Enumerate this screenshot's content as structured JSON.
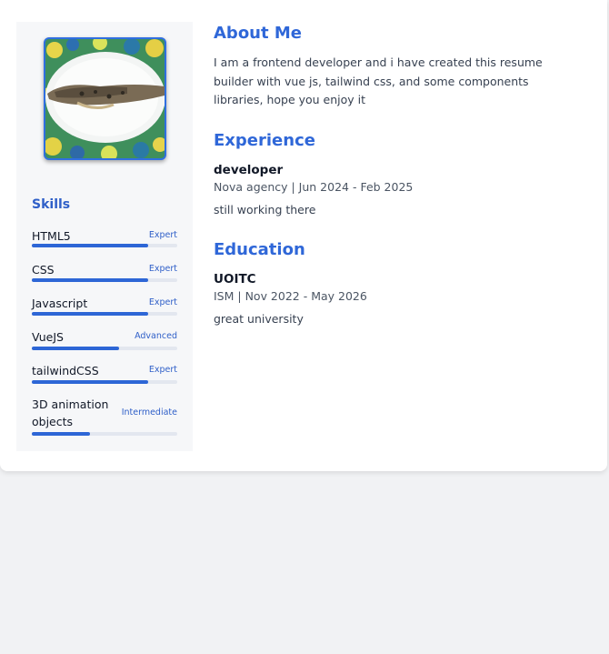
{
  "profile": {
    "photo_alt": "profile photo of a fish on a plate"
  },
  "skills": {
    "title": "Skills",
    "items": [
      {
        "name": "HTML5",
        "level": "Expert",
        "progress": 0.8
      },
      {
        "name": "CSS",
        "level": "Expert",
        "progress": 0.8
      },
      {
        "name": "Javascript",
        "level": "Expert",
        "progress": 0.8
      },
      {
        "name": "VueJS",
        "level": "Advanced",
        "progress": 0.6
      },
      {
        "name": "tailwindCSS",
        "level": "Expert",
        "progress": 0.8
      },
      {
        "name": "3D animation objects",
        "level": "Intermediate",
        "progress": 0.4
      }
    ]
  },
  "about": {
    "title": "About Me",
    "text": "I am a frontend developer and i have created this resume builder with vue js, tailwind css, and some components libraries, hope you enjoy it"
  },
  "experience": {
    "title": "Experience",
    "items": [
      {
        "role": "developer",
        "meta": "Nova agency | Jun 2024 - Feb 2025",
        "description": "still working there"
      }
    ]
  },
  "education": {
    "title": "Education",
    "items": [
      {
        "school": "UOITC",
        "meta": "ISM | Nov 2022 - May 2026",
        "description": "great university"
      }
    ]
  },
  "colors": {
    "accent": "#2f67d8",
    "bar": "#2d66d6",
    "page_bg": "#f1f2f4",
    "card_bg": "#ffffff"
  }
}
